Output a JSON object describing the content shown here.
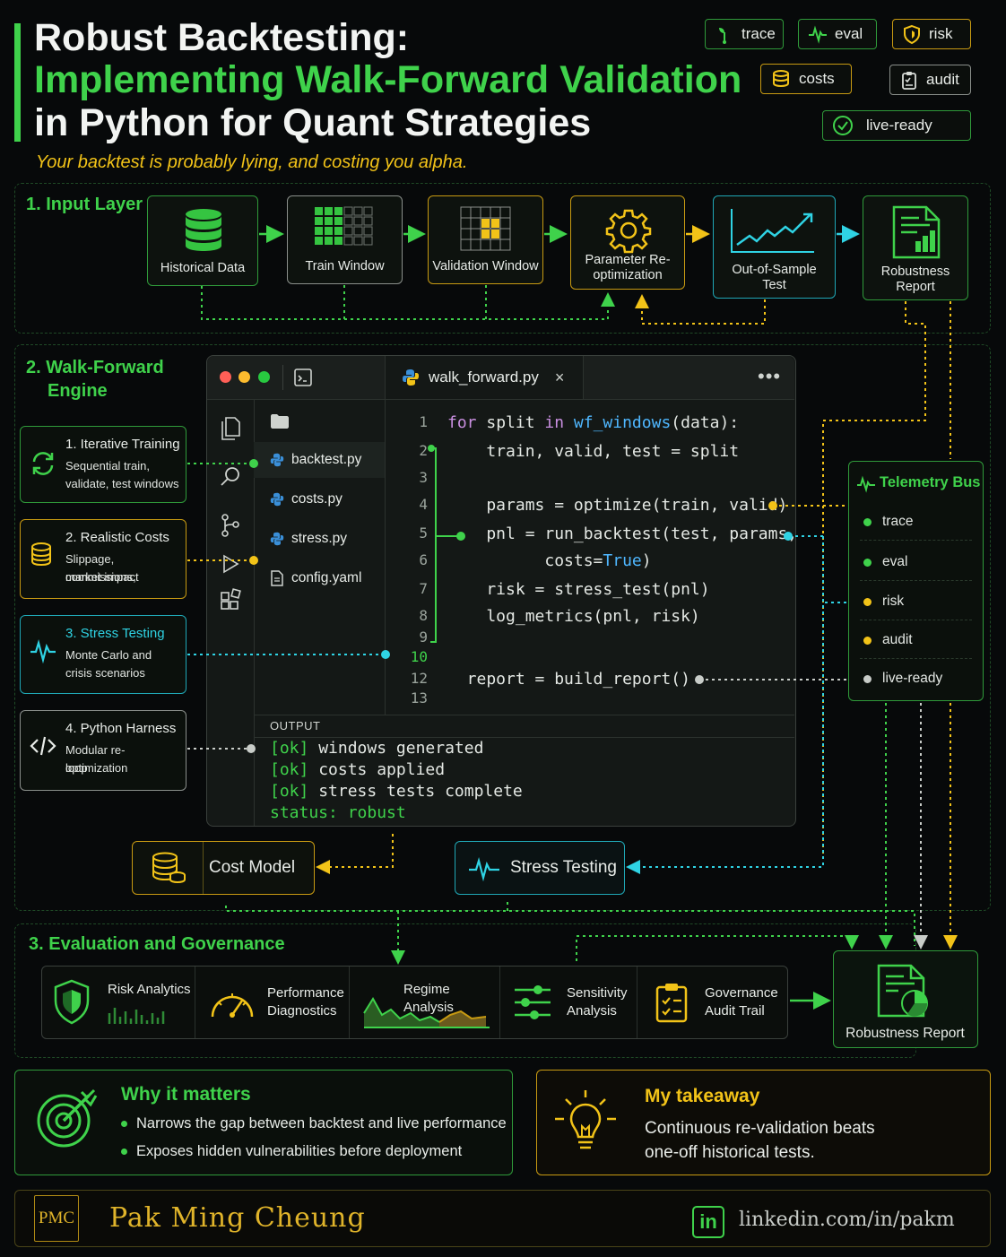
{
  "header": {
    "title_line1": "Robust Backtesting:",
    "title_line2": "Implementing Walk-Forward Validation",
    "title_line3": "in Python for Quant Strategies",
    "subtitle": "Your backtest is probably lying, and costing you alpha."
  },
  "tags": {
    "trace": "trace",
    "eval": "eval",
    "risk": "risk",
    "costs": "costs",
    "audit": "audit",
    "live_ready": "live-ready"
  },
  "input_layer": {
    "heading": "1. Input Layer",
    "steps": [
      {
        "label": "Historical Data",
        "icon": "database-icon"
      },
      {
        "label": "Train Window",
        "icon": "grid-icon"
      },
      {
        "label": "Validation Window",
        "icon": "grid-highlight-icon"
      },
      {
        "label": "Parameter Re-optimization",
        "icon": "gear-icon"
      },
      {
        "label": "Out-of-Sample Test",
        "icon": "line-chart-icon"
      },
      {
        "label": "Robustness Report",
        "icon": "report-icon"
      }
    ]
  },
  "engine": {
    "heading_line1": "2. Walk-Forward",
    "heading_line2": "Engine",
    "cards": [
      {
        "title": "1. Iterative Training",
        "desc_line1": "Sequential train,",
        "desc_line2": "validate, test windows",
        "icon": "refresh-icon"
      },
      {
        "title": "2. Realistic Costs",
        "desc_line1": "Slippage, commissions,",
        "desc_line2": "market impact",
        "icon": "coins-icon"
      },
      {
        "title": "3. Stress Testing",
        "desc_line1": "Monte Carlo and",
        "desc_line2": "crisis scenarios",
        "icon": "pulse-icon"
      },
      {
        "title": "4. Python Harness",
        "desc_line1": "Modular re-optimization",
        "desc_line2": "loop",
        "icon": "code-icon"
      }
    ]
  },
  "editor": {
    "tab_filename": "walk_forward.py",
    "files": [
      "backtest.py",
      "costs.py",
      "stress.py",
      "config.yaml"
    ],
    "lines": [
      {
        "no": "1",
        "code": "for split in wf_windows(data):"
      },
      {
        "no": "2",
        "code": "    train, valid, test = split"
      },
      {
        "no": "3",
        "code": ""
      },
      {
        "no": "4",
        "code": "    params = optimize(train, valid)"
      },
      {
        "no": "5",
        "code": "    pnl = run_backtest(test, params,"
      },
      {
        "no": "6",
        "code": "          costs=True)"
      },
      {
        "no": "7",
        "code": "    risk = stress_test(pnl)"
      },
      {
        "no": "8",
        "code": "    log_metrics(pnl, risk)"
      },
      {
        "no": "9",
        "code": ""
      },
      {
        "no": "10",
        "code": ""
      },
      {
        "no": "12",
        "code": "  report = build_report()"
      },
      {
        "no": "13",
        "code": ""
      }
    ],
    "output_label": "OUTPUT",
    "output": [
      {
        "tag": "[ok]",
        "text": "windows generated"
      },
      {
        "tag": "[ok]",
        "text": "costs applied"
      },
      {
        "tag": "[ok]",
        "text": "stress tests complete"
      }
    ],
    "status_label": "status:",
    "status_value": "robust"
  },
  "telemetry": {
    "title": "Telemetry Bus",
    "items": [
      {
        "label": "trace",
        "color": "#3fd24b"
      },
      {
        "label": "eval",
        "color": "#3fd24b"
      },
      {
        "label": "risk",
        "color": "#f2c318"
      },
      {
        "label": "audit",
        "color": "#f2c318"
      },
      {
        "label": "live-ready",
        "color": "#c8ccc8"
      }
    ]
  },
  "modules": {
    "cost_model": "Cost Model",
    "stress_testing": "Stress Testing"
  },
  "evaluation": {
    "heading": "3. Evaluation and Governance",
    "items": [
      {
        "line1": "Risk Analytics",
        "line2": "",
        "icon": "shield-icon"
      },
      {
        "line1": "Performance",
        "line2": "Diagnostics",
        "icon": "gauge-icon"
      },
      {
        "line1": "Regime Analysis",
        "line2": "",
        "icon": "area-chart-icon"
      },
      {
        "line1": "Sensitivity",
        "line2": "Analysis",
        "icon": "sliders-icon"
      },
      {
        "line1": "Governance",
        "line2": "Audit Trail",
        "icon": "checklist-icon"
      }
    ],
    "report_label": "Robustness Report"
  },
  "why": {
    "title": "Why it matters",
    "bullets": [
      "Narrows the gap between backtest and live performance",
      "Exposes hidden vulnerabilities before deployment"
    ]
  },
  "takeaway": {
    "title": "My takeaway",
    "line1": "Continuous re-validation beats",
    "line2": "one-off historical tests."
  },
  "footer": {
    "logo": "PMC",
    "name": "Pak Ming Cheung",
    "link": "linkedin.com/in/pakm",
    "linkedin_badge": "in"
  },
  "colors": {
    "green": "#3fd24b",
    "yellow": "#f2c318",
    "cyan": "#2fd3e4",
    "background": "#07090a"
  }
}
